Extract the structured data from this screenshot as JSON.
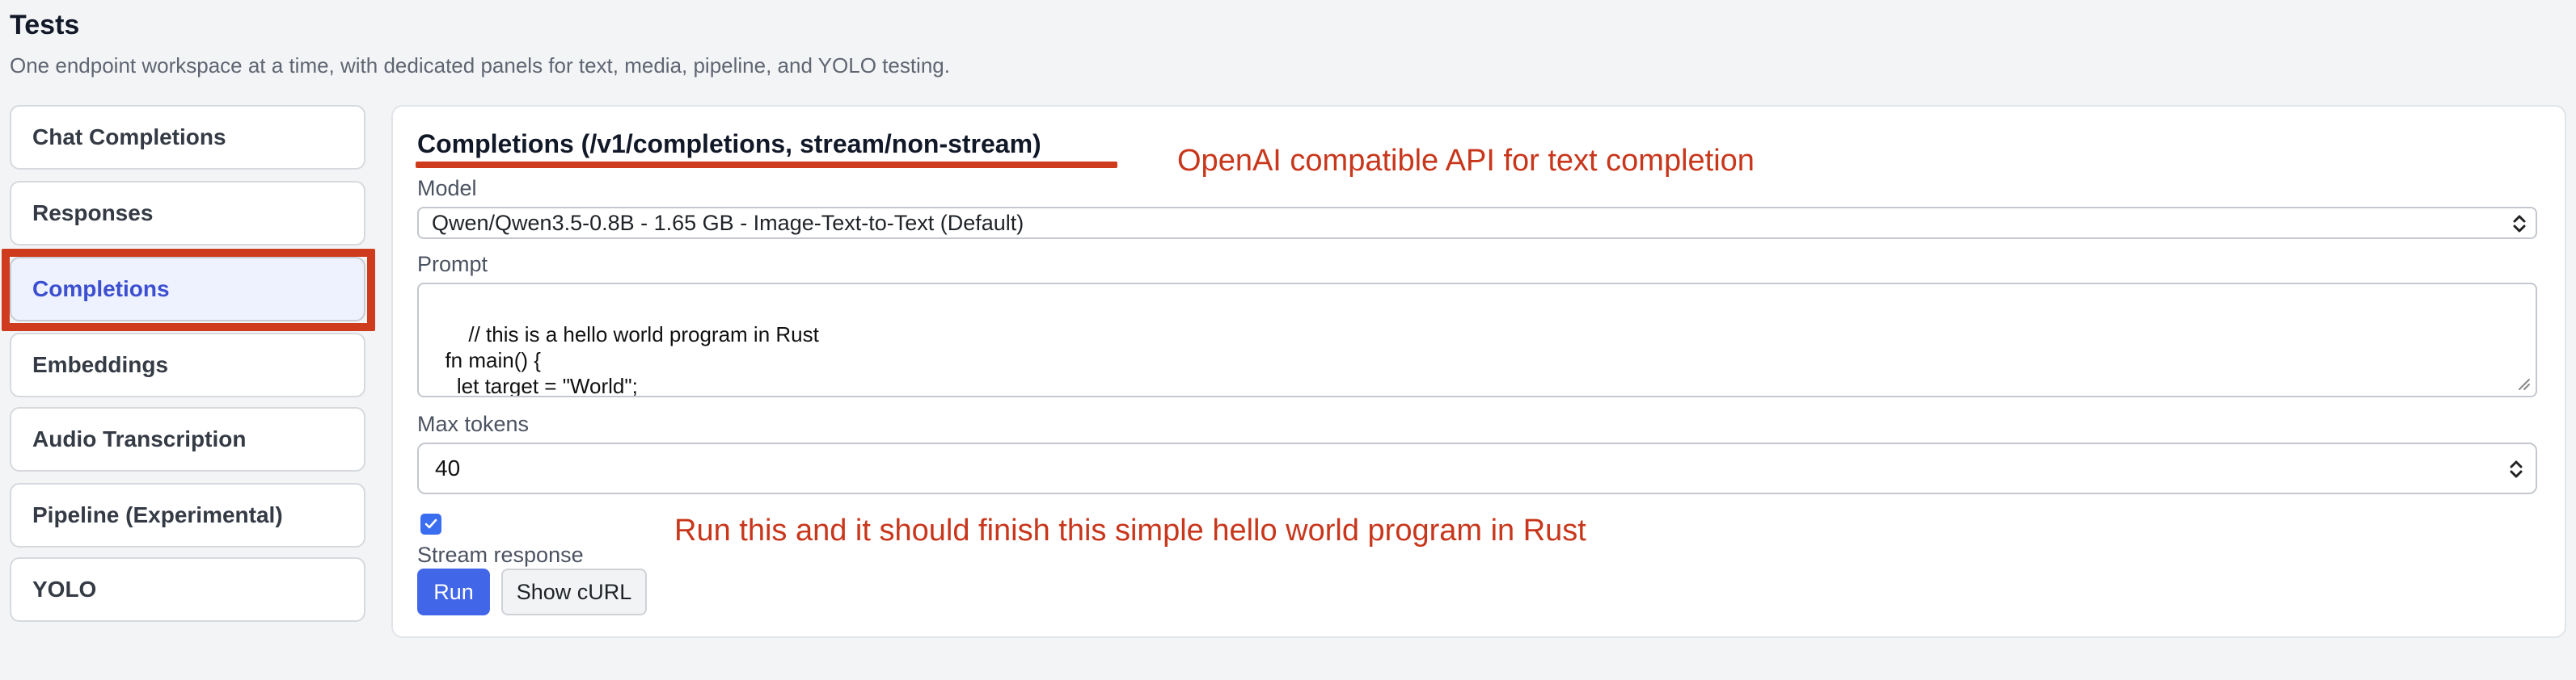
{
  "header": {
    "title": "Tests",
    "subtitle": "One endpoint workspace at a time, with dedicated panels for text, media, pipeline, and YOLO testing."
  },
  "sidebar": {
    "items": [
      {
        "label": "Chat Completions"
      },
      {
        "label": "Responses"
      },
      {
        "label": "Completions",
        "active": true
      },
      {
        "label": "Embeddings"
      },
      {
        "label": "Audio Transcription"
      },
      {
        "label": "Pipeline (Experimental)"
      },
      {
        "label": "YOLO"
      }
    ]
  },
  "panel": {
    "title": "Completions (/v1/completions, stream/non-stream)",
    "model": {
      "label": "Model",
      "value": "Qwen/Qwen3.5-0.8B - 1.65 GB - Image-Text-to-Text (Default)"
    },
    "prompt": {
      "label": "Prompt",
      "value": "// this is a hello world program in Rust\n  fn main() {\n    let target = \"World\";\n    if target == \"World\" {"
    },
    "max_tokens": {
      "label": "Max tokens",
      "value": "40"
    },
    "stream": {
      "label": "Stream response",
      "checked": true
    },
    "run_label": "Run",
    "curl_label": "Show cURL"
  },
  "annotations": {
    "api_note": "OpenAI compatible API for text completion",
    "run_note": "Run this  and it should finish this simple hello world program in Rust"
  },
  "colors": {
    "annotation": "#cf3b1d",
    "primary": "#4266e8",
    "active_nav_text": "#3b4fd0",
    "active_nav_bg": "#eef2ff"
  }
}
